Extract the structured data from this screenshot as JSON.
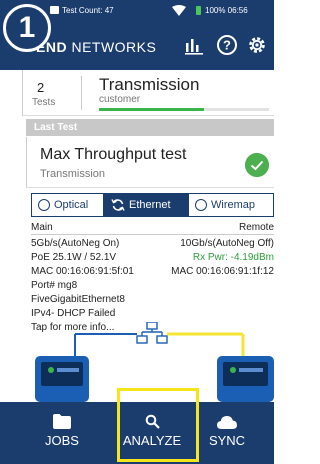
{
  "step": "1",
  "status_bar": {
    "test_count": "Test Count: 47",
    "battery": "100% 06:56"
  },
  "app_bar": {
    "brand_bold": "END",
    "brand_rest": "NETWORKS"
  },
  "summary": {
    "tests_count": "2",
    "tests_label": "Tests",
    "title": "Transmission",
    "subtitle": "customer",
    "progress_fraction": 0.62
  },
  "last_test": {
    "header": "Last Test",
    "title": "Max Throughput test",
    "subtitle": "Transmission",
    "status": "passed"
  },
  "tabs": [
    {
      "label": "Optical",
      "active": false
    },
    {
      "label": "Ethernet",
      "active": true
    },
    {
      "label": "Wiremap",
      "active": false
    }
  ],
  "details": {
    "main_header": "Main",
    "remote_header": "Remote",
    "main_lines": [
      "5Gb/s(AutoNeg On)",
      "PoE 25.1W / 52.1V",
      "MAC 00:16:06:91:5f:01",
      "Port# mg8",
      "FiveGigabitEthernet8",
      "IPv4- DHCP Failed",
      "Tap for more info..."
    ],
    "remote_lines": [
      "10Gb/s(AutoNeg Off)",
      "Rx Pwr: -4.19dBm",
      "MAC 00:16:06:91:1f:12"
    ]
  },
  "nav": {
    "jobs": "JOBS",
    "analyze": "ANALYZE",
    "sync": "SYNC"
  },
  "colors": {
    "primary": "#1b3d6e",
    "success": "#4caf50",
    "highlight": "#f6e51b",
    "link_yellow": "#f5e533"
  }
}
